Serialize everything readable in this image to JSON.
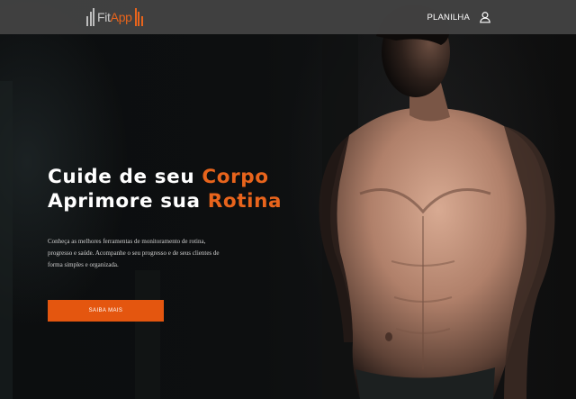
{
  "brand": {
    "logo_part1": "Fit",
    "logo_part2": "App",
    "colors": {
      "accent": "#e8641c",
      "navbar": "#444444",
      "button": "#e4560f"
    }
  },
  "navbar": {
    "link_label": "PLANILHA",
    "user_icon": "user-icon"
  },
  "hero": {
    "line1_prefix": "Cuide de seu ",
    "line1_accent": "Corpo",
    "line2_prefix": "Aprimore sua ",
    "line2_accent": "Rotina",
    "description_lines": [
      "Conheça as melhores ferramentas de monitoramento de rotina,",
      "progresso e saúde. Acompanhe o seu progresso e de seus clientes de",
      "forma simples e organizada."
    ],
    "cta_label": "SAIBA MAIS"
  }
}
